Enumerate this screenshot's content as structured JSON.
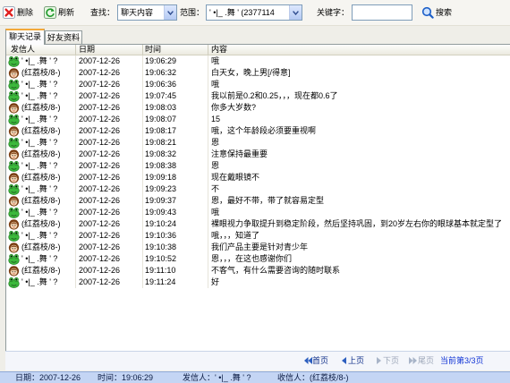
{
  "toolbar": {
    "delete_label": "删除",
    "refresh_label": "刷新",
    "find_label": "查找：",
    "find_select": "聊天内容",
    "range_label": "范围：",
    "range_select": "' •|_ .舞 ' (2377114",
    "keyword_label": "关键字：",
    "keyword_value": "",
    "search_label": "搜索"
  },
  "tabs": [
    {
      "label": "聊天记录",
      "active": true
    },
    {
      "label": "好友资料",
      "active": false
    }
  ],
  "table": {
    "columns": [
      "发信人",
      "日期",
      "时间",
      "内容"
    ],
    "rows": [
      {
        "sender": "' •|_ .舞 ' ?",
        "avatar": "frog-avatar-icon",
        "date": "2007-12-26",
        "time": "19:06:29",
        "content": "哦"
      },
      {
        "sender": "(红荔枝/8-)",
        "avatar": "girl-avatar-icon",
        "date": "2007-12-26",
        "time": "19:06:32",
        "content": "白天女，晚上男[/得意]"
      },
      {
        "sender": "' •|_ .舞 ' ?",
        "avatar": "frog-avatar-icon",
        "date": "2007-12-26",
        "time": "19:06:36",
        "content": "哦"
      },
      {
        "sender": "' •|_ .舞 ' ?",
        "avatar": "frog-avatar-icon",
        "date": "2007-12-26",
        "time": "19:07:45",
        "content": "我以前是0.2和0.25，，，现在都0.6了"
      },
      {
        "sender": "(红荔枝/8-)",
        "avatar": "girl-avatar-icon",
        "date": "2007-12-26",
        "time": "19:08:03",
        "content": "你多大岁数?"
      },
      {
        "sender": "' •|_ .舞 ' ?",
        "avatar": "frog-avatar-icon",
        "date": "2007-12-26",
        "time": "19:08:07",
        "content": "15"
      },
      {
        "sender": "(红荔枝/8-)",
        "avatar": "girl-avatar-icon",
        "date": "2007-12-26",
        "time": "19:08:17",
        "content": "哦，这个年龄段必须要重视啊"
      },
      {
        "sender": "' •|_ .舞 ' ?",
        "avatar": "frog-avatar-icon",
        "date": "2007-12-26",
        "time": "19:08:21",
        "content": "恩"
      },
      {
        "sender": "(红荔枝/8-)",
        "avatar": "girl-avatar-icon",
        "date": "2007-12-26",
        "time": "19:08:32",
        "content": "注意保持最重要"
      },
      {
        "sender": "' •|_ .舞 ' ?",
        "avatar": "frog-avatar-icon",
        "date": "2007-12-26",
        "time": "19:08:38",
        "content": "恩"
      },
      {
        "sender": "(红荔枝/8-)",
        "avatar": "girl-avatar-icon",
        "date": "2007-12-26",
        "time": "19:09:18",
        "content": "现在戴眼镜不"
      },
      {
        "sender": "' •|_ .舞 ' ?",
        "avatar": "frog-avatar-icon",
        "date": "2007-12-26",
        "time": "19:09:23",
        "content": "不"
      },
      {
        "sender": "(红荔枝/8-)",
        "avatar": "girl-avatar-icon",
        "date": "2007-12-26",
        "time": "19:09:37",
        "content": "恩，最好不带，带了就容易定型"
      },
      {
        "sender": "' •|_ .舞 ' ?",
        "avatar": "frog-avatar-icon",
        "date": "2007-12-26",
        "time": "19:09:43",
        "content": "哦"
      },
      {
        "sender": "(红荔枝/8-)",
        "avatar": "girl-avatar-icon",
        "date": "2007-12-26",
        "time": "19:10:24",
        "content": "裸眼视力争取提升到稳定阶段，然后坚持巩固，到20岁左右你的眼球基本就定型了"
      },
      {
        "sender": "' •|_ .舞 ' ?",
        "avatar": "frog-avatar-icon",
        "date": "2007-12-26",
        "time": "19:10:36",
        "content": "哦，，，知道了"
      },
      {
        "sender": "(红荔枝/8-)",
        "avatar": "girl-avatar-icon",
        "date": "2007-12-26",
        "time": "19:10:38",
        "content": "我们产品主要是针对青少年"
      },
      {
        "sender": "' •|_ .舞 ' ?",
        "avatar": "frog-avatar-icon",
        "date": "2007-12-26",
        "time": "19:10:52",
        "content": "恩，，，在这也感谢你们"
      },
      {
        "sender": "(红荔枝/8-)",
        "avatar": "girl-avatar-icon",
        "date": "2007-12-26",
        "time": "19:11:10",
        "content": "不客气，有什么需要咨询的随时联系"
      },
      {
        "sender": "' •|_ .舞 ' ?",
        "avatar": "frog-avatar-icon",
        "date": "2007-12-26",
        "time": "19:11:24",
        "content": "好"
      }
    ]
  },
  "pagination": {
    "first": "首页",
    "prev": "上页",
    "next": "下页",
    "last": "尾页",
    "current": "当前第3/3页",
    "next_enabled": false,
    "last_enabled": false
  },
  "status_bar": {
    "date_label": "日期：",
    "date": "2007-12-26",
    "time_label": "时间：",
    "time": "19:06:29",
    "sender_label": "发信人：",
    "sender": "' •|_ .舞 ' ?",
    "receiver_label": "收信人：",
    "receiver": "(红荔枝/8-)"
  },
  "colors": {
    "status_bar": "#c4d5f4",
    "current_page": "#1034d6",
    "disabled_page": "#9da7b8",
    "active_tab_accent": "#f3a93a"
  }
}
